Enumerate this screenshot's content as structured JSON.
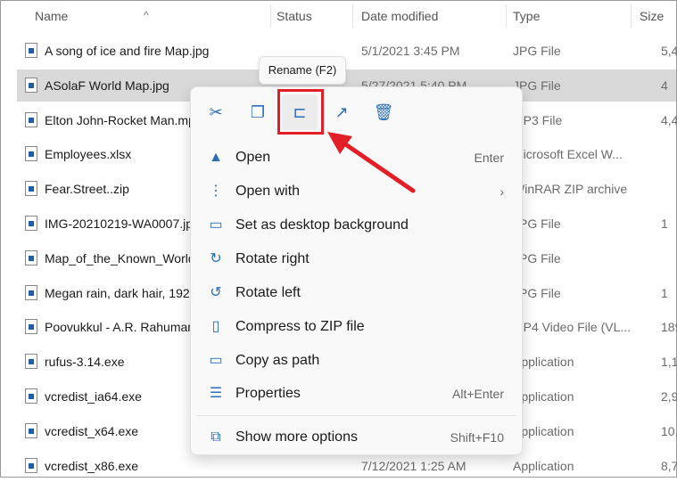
{
  "header": {
    "name": "Name",
    "status": "Status",
    "date": "Date modified",
    "type": "Type",
    "size": "Size"
  },
  "files": [
    {
      "name": "A song of ice and fire Map.jpg",
      "date": "5/1/2021 3:45 PM",
      "type": "JPG File",
      "size": "5,4",
      "icon": "image-file-icon"
    },
    {
      "name": "ASolaF World Map.jpg",
      "date": "5/27/2021 5:40 PM",
      "type": "JPG File",
      "size": "4",
      "icon": "image-file-icon",
      "selected": true
    },
    {
      "name": "Elton John-Rocket Man.mp3",
      "date": "",
      "type": "MP3 File",
      "size": "4,4",
      "icon": "audio-file-icon"
    },
    {
      "name": "Employees.xlsx",
      "date": "",
      "type": "Microsoft Excel W...",
      "size": "",
      "icon": "excel-file-icon"
    },
    {
      "name": "Fear.Street..zip",
      "date": "",
      "type": "WinRAR ZIP archive",
      "size": "",
      "icon": "winrar-icon"
    },
    {
      "name": "IMG-20210219-WA0007.jpg",
      "date": "",
      "type": "JPG File",
      "size": "1",
      "icon": "image-file-icon"
    },
    {
      "name": "Map_of_the_Known_World",
      "date": "",
      "type": "JPG File",
      "size": "",
      "icon": "image-file-icon"
    },
    {
      "name": "Megan rain, dark hair, 192",
      "date": "",
      "type": "JPG File",
      "size": "1",
      "icon": "image-file-icon"
    },
    {
      "name": "Poovukkul - A.R. Rahuman",
      "date": "",
      "type": "MP4 Video File (VL...",
      "size": "189,9",
      "icon": "vlc-icon"
    },
    {
      "name": "rufus-3.14.exe",
      "date": "",
      "type": "Application",
      "size": "1,1",
      "icon": "usb-icon"
    },
    {
      "name": "vcredist_ia64.exe",
      "date": "",
      "type": "Application",
      "size": "2,9",
      "icon": "installer-icon"
    },
    {
      "name": "vcredist_x64.exe",
      "date": "",
      "type": "Application",
      "size": "10,0",
      "icon": "installer-icon"
    },
    {
      "name": "vcredist_x86.exe",
      "date": "7/12/2021 1:25 AM",
      "type": "Application",
      "size": "8,7",
      "icon": "installer-icon"
    }
  ],
  "tooltip": "Rename (F2)",
  "toolbar": [
    {
      "name": "cut-icon",
      "glyph": "✂"
    },
    {
      "name": "copy-icon",
      "glyph": "❐"
    },
    {
      "name": "rename-icon",
      "glyph": "⊏"
    },
    {
      "name": "share-icon",
      "glyph": "↗"
    },
    {
      "name": "delete-icon",
      "glyph": "🗑"
    }
  ],
  "menu": [
    {
      "label": "Open",
      "shortcut": "Enter",
      "icon": "image-icon",
      "glyph": "▲"
    },
    {
      "label": "Open with",
      "shortcut": "›",
      "icon": "open-with-icon",
      "glyph": "⋮"
    },
    {
      "label": "Set as desktop background",
      "shortcut": "",
      "icon": "desktop-background-icon",
      "glyph": "▭"
    },
    {
      "label": "Rotate right",
      "shortcut": "",
      "icon": "rotate-right-icon",
      "glyph": "↻"
    },
    {
      "label": "Rotate left",
      "shortcut": "",
      "icon": "rotate-left-icon",
      "glyph": "↺"
    },
    {
      "label": "Compress to ZIP file",
      "shortcut": "",
      "icon": "zip-folder-icon",
      "glyph": "▯"
    },
    {
      "label": "Copy as path",
      "shortcut": "",
      "icon": "copy-path-icon",
      "glyph": "▭"
    },
    {
      "label": "Properties",
      "shortcut": "Alt+Enter",
      "icon": "properties-icon",
      "glyph": "☰"
    },
    {
      "label": "Show more options",
      "shortcut": "Shift+F10",
      "icon": "show-more-icon",
      "glyph": "⧉"
    }
  ],
  "colors": {
    "highlight": "#e41e26",
    "accent": "#2a6ebb",
    "selection": "#d9d9d9"
  }
}
